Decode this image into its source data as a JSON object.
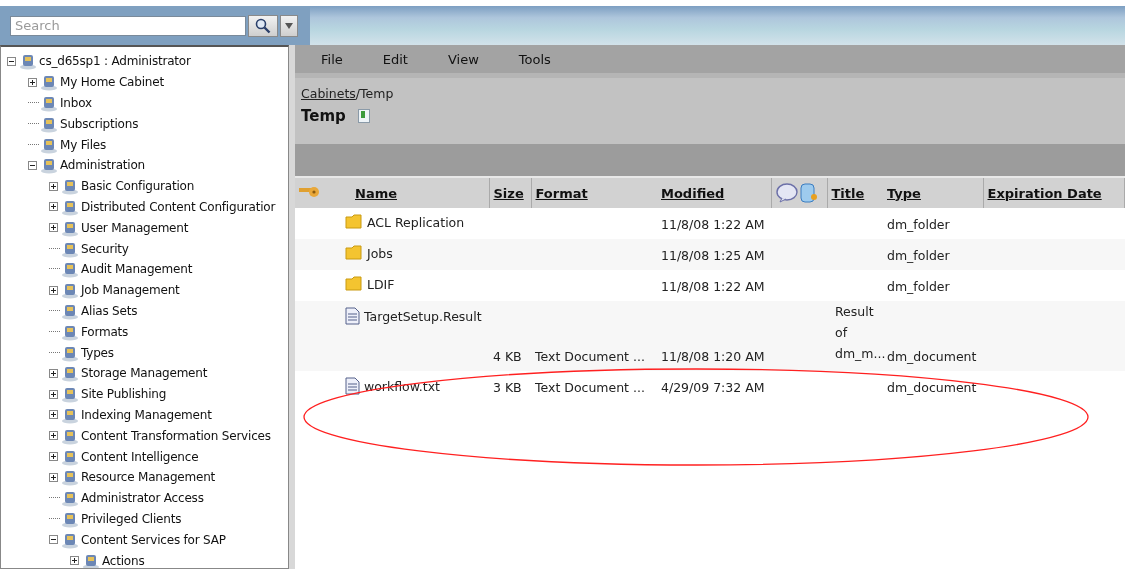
{
  "search": {
    "placeholder": "Search"
  },
  "tree": [
    {
      "label": "cs_d65sp1 : Administrator",
      "expanded": true,
      "children": [
        {
          "label": "My Home Cabinet",
          "expanded": false
        },
        {
          "label": "Inbox"
        },
        {
          "label": "Subscriptions"
        },
        {
          "label": "My Files"
        },
        {
          "label": "Administration",
          "expanded": true,
          "children": [
            {
              "label": "Basic Configuration",
              "expanded": false
            },
            {
              "label": "Distributed Content Configuratior",
              "expanded": false
            },
            {
              "label": "User Management",
              "expanded": false
            },
            {
              "label": "Security"
            },
            {
              "label": "Audit Management"
            },
            {
              "label": "Job Management",
              "expanded": false
            },
            {
              "label": "Alias Sets"
            },
            {
              "label": "Formats"
            },
            {
              "label": "Types"
            },
            {
              "label": "Storage Management",
              "expanded": false
            },
            {
              "label": "Site Publishing",
              "expanded": false
            },
            {
              "label": "Indexing Management",
              "expanded": false
            },
            {
              "label": "Content Transformation Services",
              "expanded": false
            },
            {
              "label": "Content Intelligence",
              "expanded": false
            },
            {
              "label": "Resource Management",
              "expanded": false
            },
            {
              "label": "Administrator Access"
            },
            {
              "label": "Privileged Clients"
            },
            {
              "label": "Content Services for SAP",
              "expanded": true,
              "children": [
                {
                  "label": "Actions",
                  "expanded": false
                }
              ]
            }
          ]
        }
      ]
    }
  ],
  "menu": [
    "File",
    "Edit",
    "View",
    "Tools"
  ],
  "breadcrumb": {
    "link": "Cabinets",
    "rest": "/Temp"
  },
  "folder_title": "Temp",
  "table": {
    "columns": [
      "Name",
      "Size",
      "Format",
      "Modified",
      "Title",
      "Type",
      "Expiration Date"
    ],
    "rows": [
      {
        "kind": "folder",
        "name": "ACL Replication",
        "size": "",
        "format": "",
        "modified": "11/8/08 1:22 AM",
        "title": "",
        "type": "dm_folder"
      },
      {
        "kind": "folder",
        "name": "Jobs",
        "size": "",
        "format": "",
        "modified": "11/8/08 1:25 AM",
        "title": "",
        "type": "dm_folder"
      },
      {
        "kind": "folder",
        "name": "LDIF",
        "size": "",
        "format": "",
        "modified": "11/8/08 1:22 AM",
        "title": "",
        "type": "dm_folder"
      },
      {
        "kind": "document",
        "name": "TargetSetup.Result",
        "size": "4 KB",
        "format": "Text Document ...",
        "modified": "11/8/08 1:20 AM",
        "title": "Result of dm_m...",
        "type": "dm_document"
      },
      {
        "kind": "document",
        "name": "workflow.txt",
        "size": "3 KB",
        "format": "Text Document ...",
        "modified": "4/29/09 7:32 AM",
        "title": "",
        "type": "dm_document"
      }
    ]
  }
}
